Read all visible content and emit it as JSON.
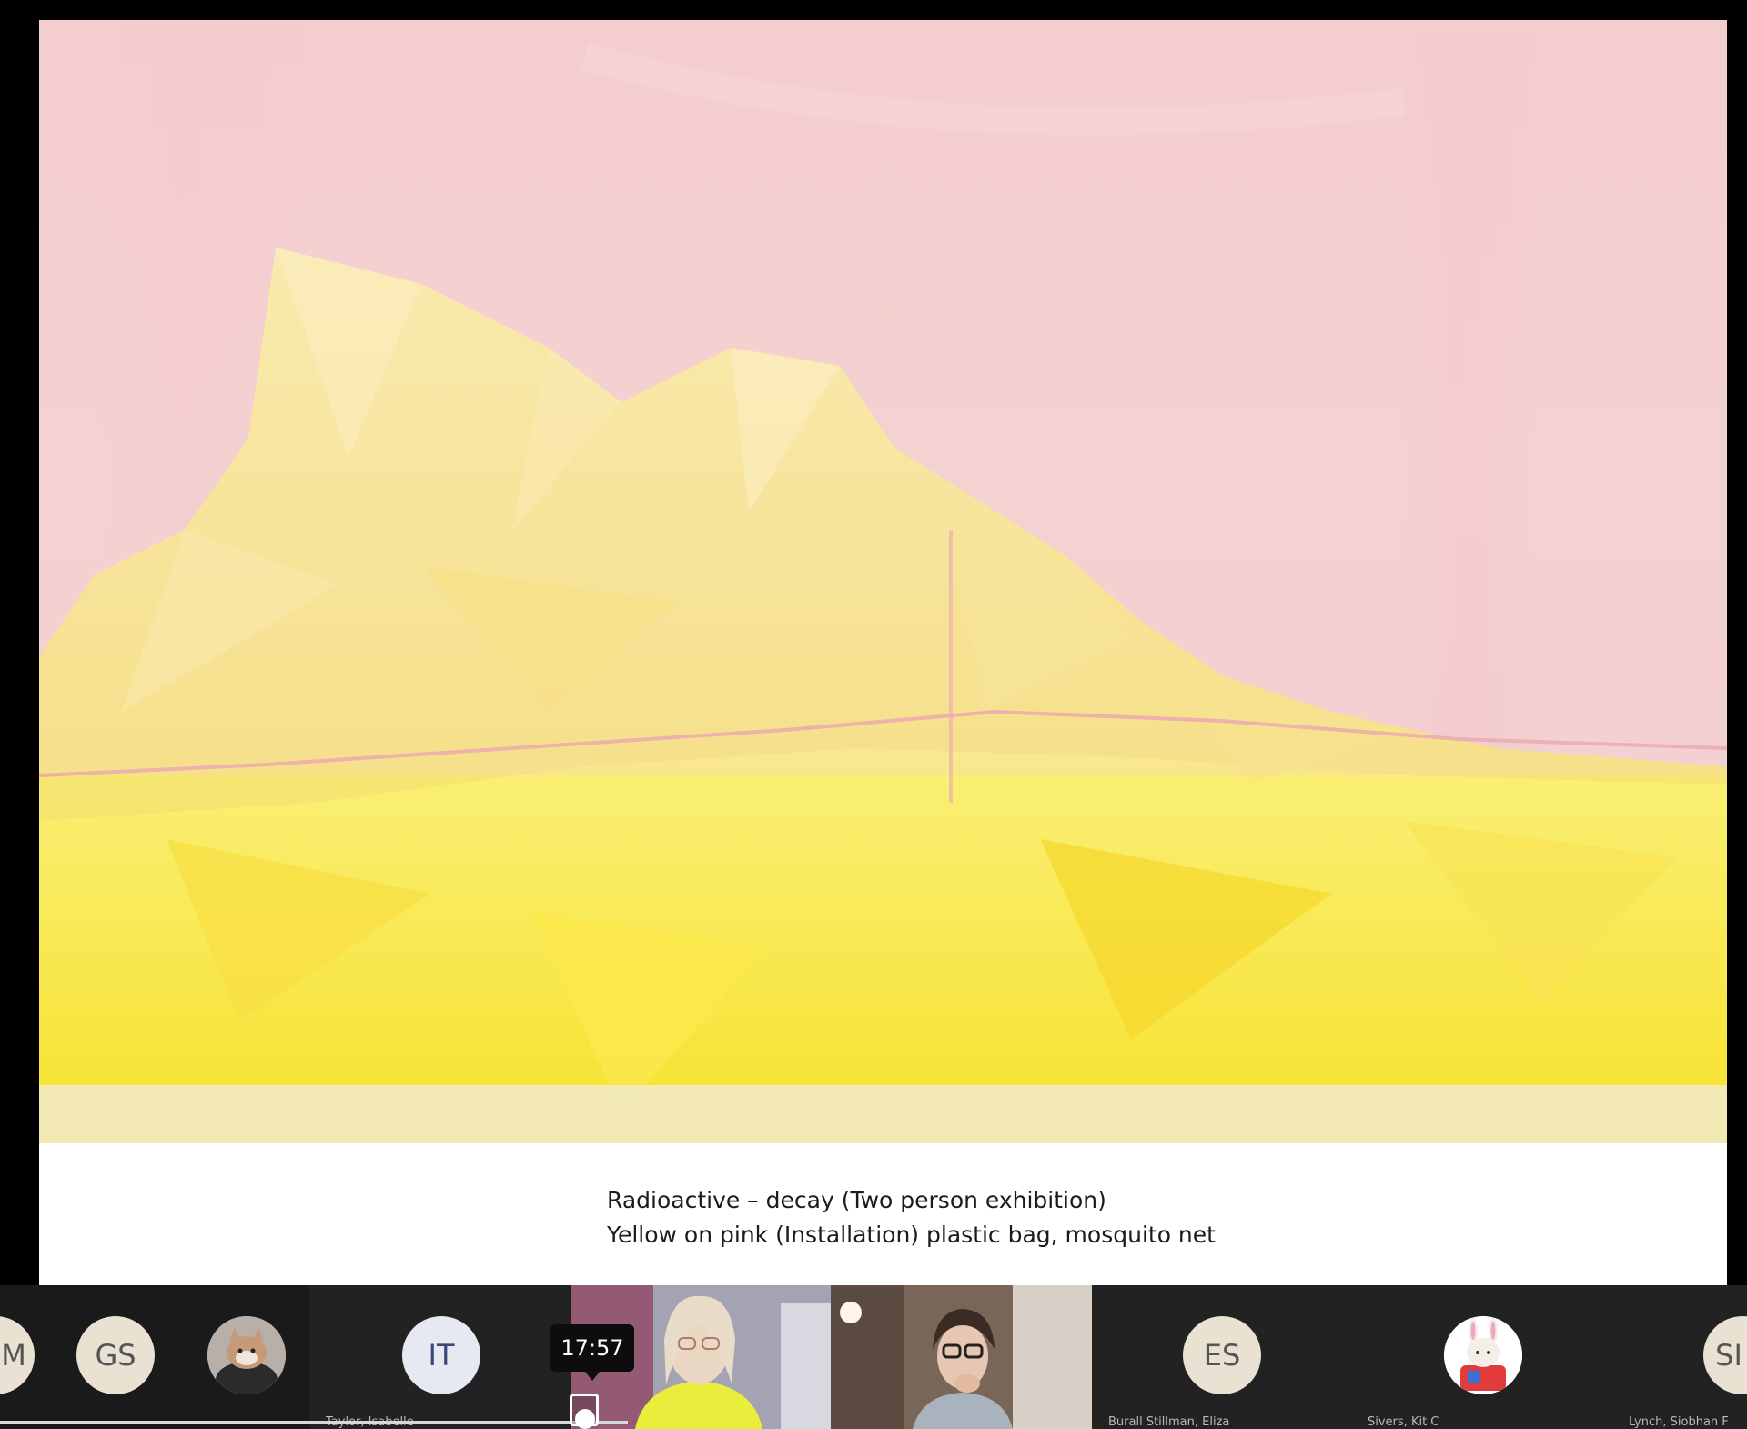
{
  "slide": {
    "caption_line1": "Radioactive – decay (Two person exhibition)",
    "caption_line2": "Yellow on pink (Installation) plastic bag, mosquito net"
  },
  "participants": [
    {
      "initials": "M",
      "name": ""
    },
    {
      "initials": "GS",
      "name": ""
    },
    {
      "avatar_icon": "cat-avatar-icon",
      "name": ""
    },
    {
      "initials": "IT",
      "name": "Taylor, Isabelle"
    },
    {
      "video": "participant-video",
      "name": ""
    },
    {
      "video": "participant-video",
      "name": ""
    },
    {
      "initials": "ES",
      "name": "Burall Stillman, Eliza"
    },
    {
      "avatar_icon": "rabbit-avatar-icon",
      "name": "Sivers, Kit C"
    },
    {
      "initials": "SI",
      "name": "Lynch, Siobhan F"
    }
  ],
  "playback": {
    "time": "17:57",
    "progress": 0.33
  },
  "colors": {
    "strip_bg": "#1a1a1a",
    "net_pink": "#f4cccd",
    "bag_yellow": "#f7e43a"
  }
}
